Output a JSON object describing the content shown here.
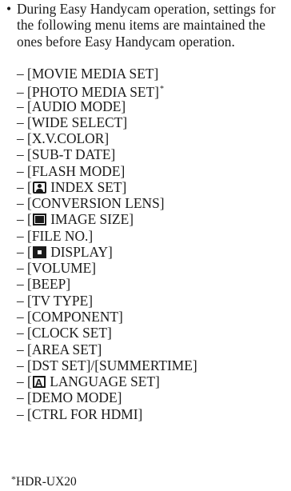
{
  "intro": {
    "bullet": "•",
    "text": "During Easy Handycam operation, settings for the following menu items are maintained the ones before Easy Handycam operation."
  },
  "items": [
    {
      "before": "– [MOVIE MEDIA SET]",
      "icon": null,
      "after": "",
      "note": ""
    },
    {
      "before": "– [PHOTO MEDIA SET]",
      "icon": null,
      "after": "",
      "note": "*"
    },
    {
      "before": "– [AUDIO MODE]",
      "icon": null,
      "after": "",
      "note": ""
    },
    {
      "before": "– [WIDE SELECT]",
      "icon": null,
      "after": "",
      "note": ""
    },
    {
      "before": "– [X.V.COLOR]",
      "icon": null,
      "after": "",
      "note": ""
    },
    {
      "before": "– [SUB-T DATE]",
      "icon": null,
      "after": "",
      "note": ""
    },
    {
      "before": "– [FLASH MODE]",
      "icon": null,
      "after": "",
      "note": ""
    },
    {
      "before": "– [",
      "icon": "face-index-icon",
      "after": " INDEX SET]",
      "note": ""
    },
    {
      "before": "– [CONVERSION LENS]",
      "icon": null,
      "after": "",
      "note": ""
    },
    {
      "before": "– [",
      "icon": "image-size-icon",
      "after": " IMAGE SIZE]",
      "note": ""
    },
    {
      "before": "– [FILE NO.]",
      "icon": null,
      "after": "",
      "note": ""
    },
    {
      "before": "– [",
      "icon": "display-icon",
      "after": " DISPLAY]",
      "note": ""
    },
    {
      "before": "– [VOLUME]",
      "icon": null,
      "after": "",
      "note": ""
    },
    {
      "before": "– [BEEP]",
      "icon": null,
      "after": "",
      "note": ""
    },
    {
      "before": "– [TV TYPE]",
      "icon": null,
      "after": "",
      "note": ""
    },
    {
      "before": "– [COMPONENT]",
      "icon": null,
      "after": "",
      "note": ""
    },
    {
      "before": "– [CLOCK SET]",
      "icon": null,
      "after": "",
      "note": ""
    },
    {
      "before": "– [AREA SET]",
      "icon": null,
      "after": "",
      "note": ""
    },
    {
      "before": "– [DST SET]/[SUMMERTIME]",
      "icon": null,
      "after": "",
      "note": ""
    },
    {
      "before": "– [",
      "icon": "language-icon",
      "after": " LANGUAGE SET]",
      "note": ""
    },
    {
      "before": "– [DEMO MODE]",
      "icon": null,
      "after": "",
      "note": ""
    },
    {
      "before": "– [CTRL FOR HDMI]",
      "icon": null,
      "after": "",
      "note": ""
    }
  ],
  "footnote": {
    "marker": "*",
    "text": "HDR-UX20"
  }
}
